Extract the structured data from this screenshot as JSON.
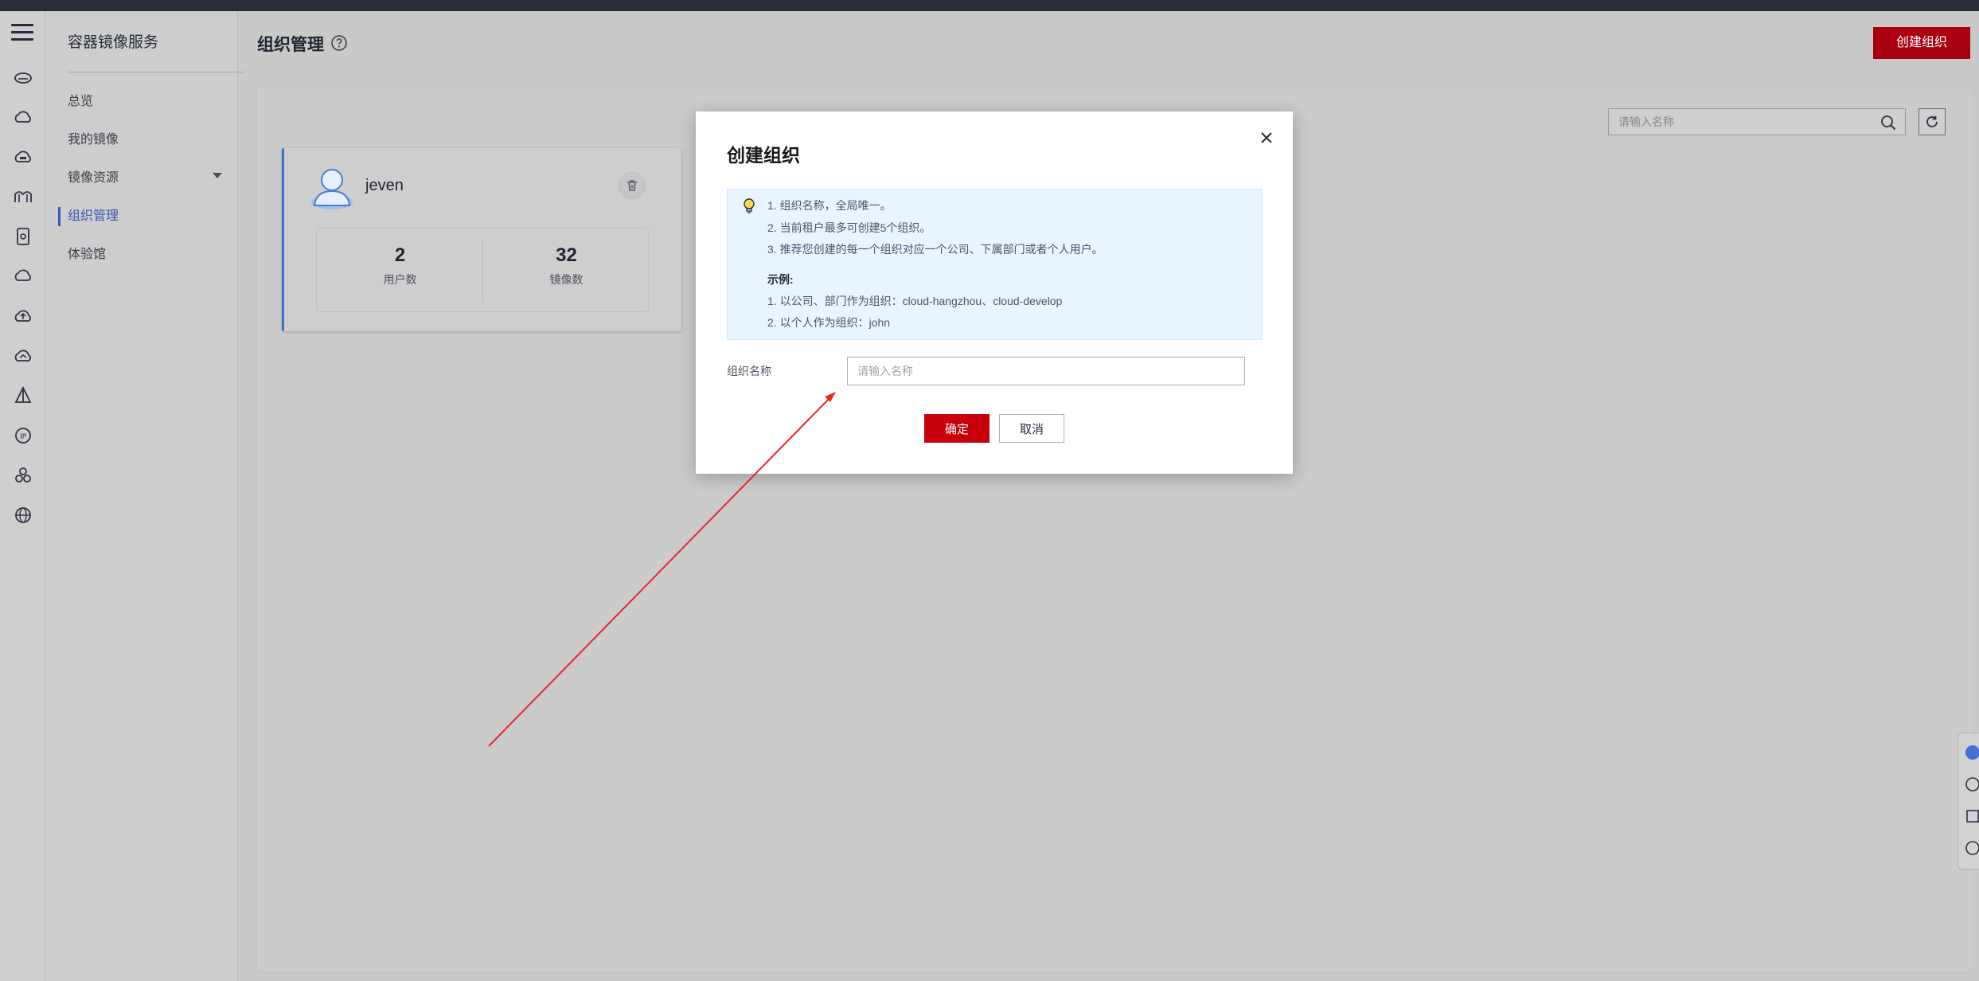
{
  "sidebar": {
    "service_title": "容器镜像服务",
    "items": [
      {
        "label": "总览"
      },
      {
        "label": "我的镜像"
      },
      {
        "label": "镜像资源"
      },
      {
        "label": "组织管理"
      },
      {
        "label": "体验馆"
      }
    ]
  },
  "header": {
    "title": "组织管理",
    "create_button": "创建组织"
  },
  "search": {
    "placeholder": "请输入名称"
  },
  "org_card": {
    "name": "jeven",
    "users_count": "2",
    "users_label": "用户数",
    "images_count": "32",
    "images_label": "镜像数"
  },
  "modal": {
    "title": "创建组织",
    "tips": [
      "1. 组织名称，全局唯一。",
      "2. 当前租户最多可创建5个组织。",
      "3. 推荐您创建的每一个组织对应一个公司、下属部门或者个人用户。"
    ],
    "example_title": "示例:",
    "examples": [
      "1. 以公司、部门作为组织：cloud-hangzhou、cloud-develop",
      "2. 以个人作为组织：john"
    ],
    "field_label": "组织名称",
    "field_placeholder": "请输入名称",
    "ok_button": "确定",
    "cancel_button": "取消"
  },
  "colors": {
    "brand_red": "#c7000b",
    "active_blue": "#3b59b8",
    "tip_bg": "#e8f4ff"
  }
}
